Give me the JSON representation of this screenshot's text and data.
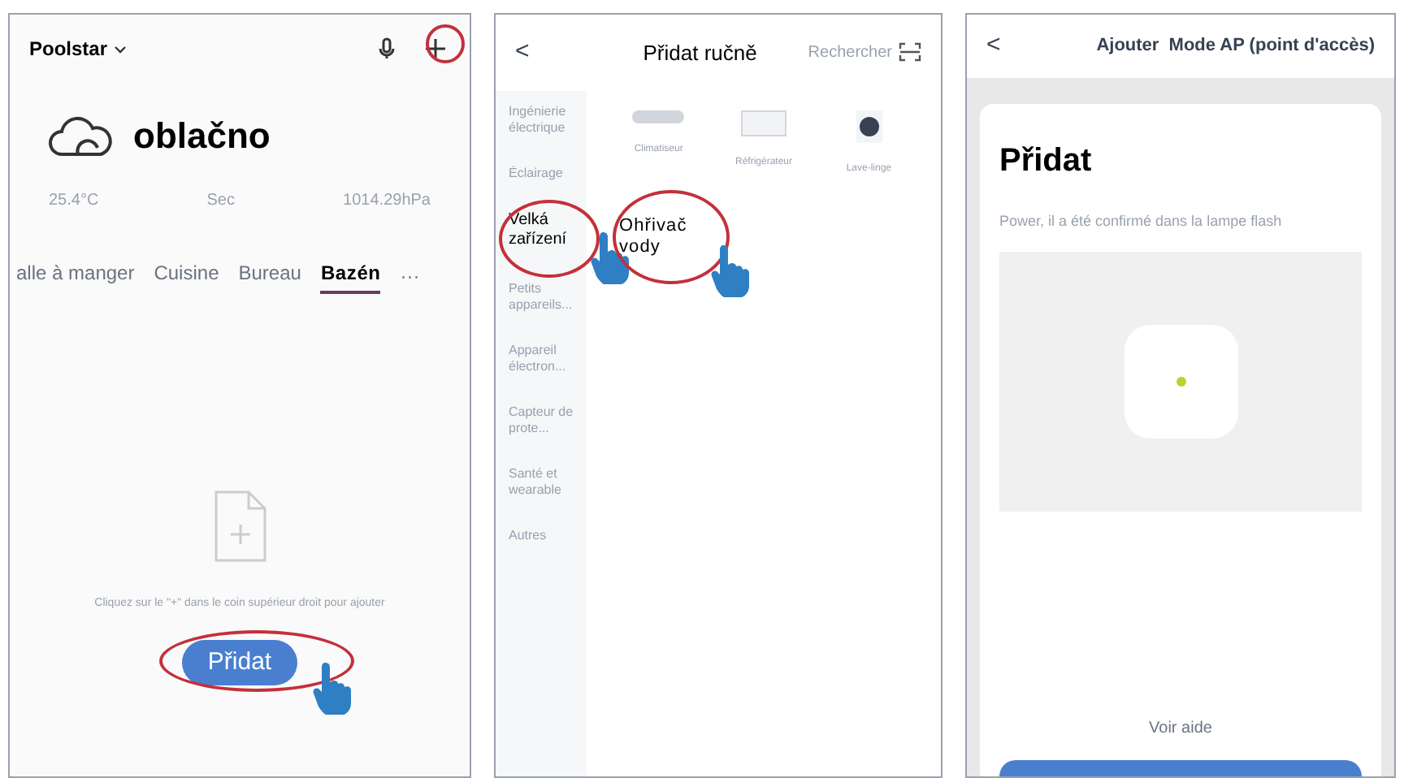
{
  "home": {
    "account": "Poolstar",
    "weather": "oblačno",
    "stats": [
      {
        "value": "25.4°C"
      },
      {
        "value": "Sec"
      },
      {
        "value": "1014.29hPa"
      }
    ],
    "rooms": [
      {
        "label": "alle à manger",
        "selected": false
      },
      {
        "label": "Cuisine",
        "selected": false
      },
      {
        "label": "Bureau",
        "selected": false
      },
      {
        "label": "Bazén",
        "selected": true
      }
    ],
    "more": "···",
    "hint": "Cliquez sur le \"+\" dans le coin supérieur droit pour ajouter",
    "add_button": "Přidat"
  },
  "manual": {
    "back": "<",
    "title": "Přidat ručně",
    "search": "Rechercher",
    "categories": [
      {
        "label": "Ingénierie électrique",
        "selected": false
      },
      {
        "label": "Éclairage",
        "selected": false
      },
      {
        "label": "Velká zařízení",
        "selected": true
      },
      {
        "label": "Petits appareils...",
        "selected": false
      },
      {
        "label": "Appareil électron...",
        "selected": false
      },
      {
        "label": "Capteur de prote...",
        "selected": false
      },
      {
        "label": "Santé et wearable",
        "selected": false
      },
      {
        "label": "Autres",
        "selected": false
      }
    ],
    "devices": [
      {
        "label": "Climatiseur",
        "kind": "ac"
      },
      {
        "label": "Réfrigérateur",
        "kind": "fridge"
      },
      {
        "label": "Lave-linge",
        "kind": "washer"
      }
    ],
    "selected_device": "Ohřivač vody"
  },
  "ap": {
    "back": "<",
    "title": "Ajouter  Mode AP (point d'accès)",
    "heading": "Přidat",
    "instruction": "Power, il a été confirmé dans la lampe flash",
    "help": "Voir aide"
  }
}
